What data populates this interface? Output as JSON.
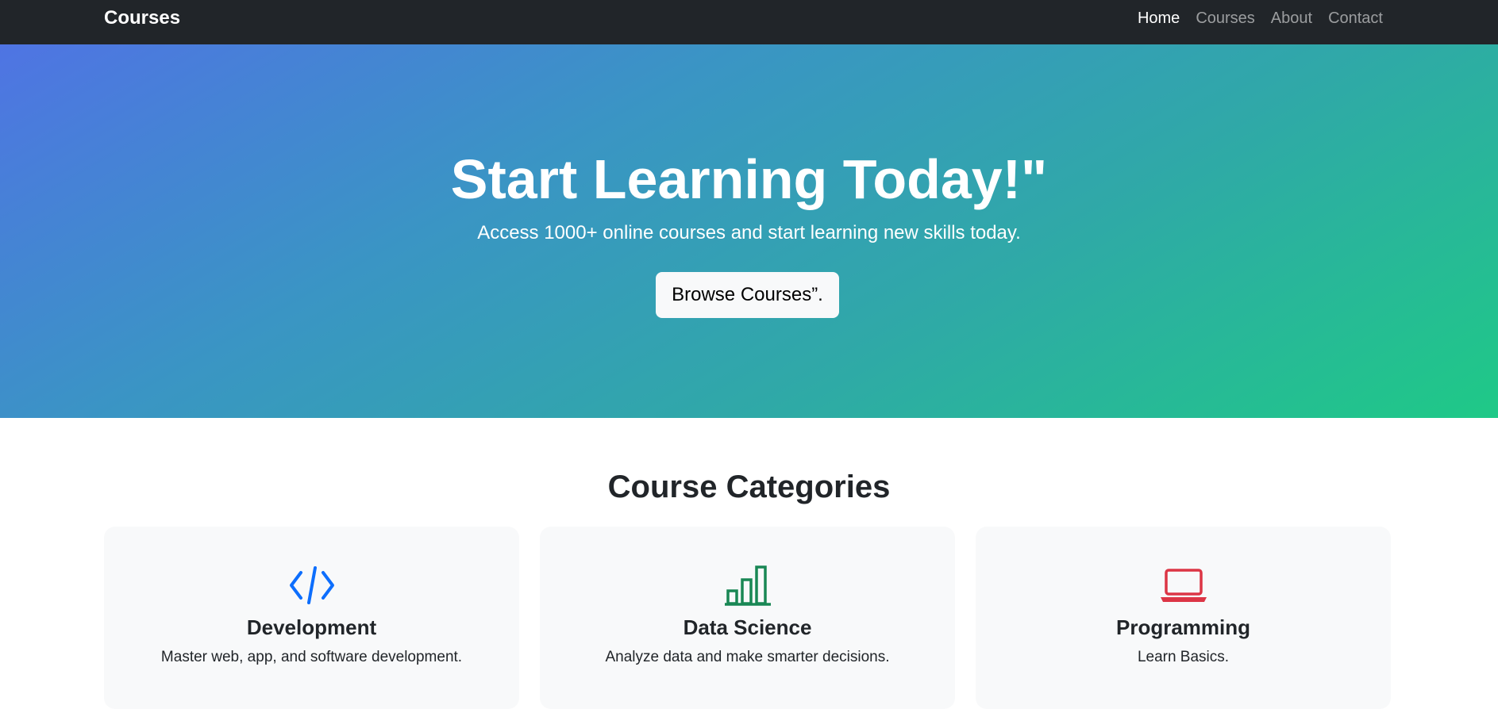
{
  "navbar": {
    "brand": "Courses",
    "links": [
      {
        "label": "Home",
        "active": true
      },
      {
        "label": "Courses",
        "active": false
      },
      {
        "label": "About",
        "active": false
      },
      {
        "label": "Contact",
        "active": false
      }
    ]
  },
  "hero": {
    "title": "Start Learning Today!\"",
    "subtitle": "Access 1000+ online courses and start learning new skills today.",
    "button_label": "Browse Courses”."
  },
  "categories": {
    "heading": "Course Categories",
    "items": [
      {
        "icon": "code-icon",
        "title": "Development",
        "description": "Master web, app, and software development.",
        "color": "#0d6efd"
      },
      {
        "icon": "bar-chart-icon",
        "title": "Data Science",
        "description": "Analyze data and make smarter decisions.",
        "color": "#198754"
      },
      {
        "icon": "laptop-icon",
        "title": "Programming",
        "description": "Learn Basics.",
        "color": "#dc3545"
      }
    ]
  },
  "colors": {
    "navbar_bg": "#212529",
    "hero_gradient_start": "#4f74e3",
    "hero_gradient_end": "#1fc987",
    "card_bg": "#f8f9fa"
  }
}
